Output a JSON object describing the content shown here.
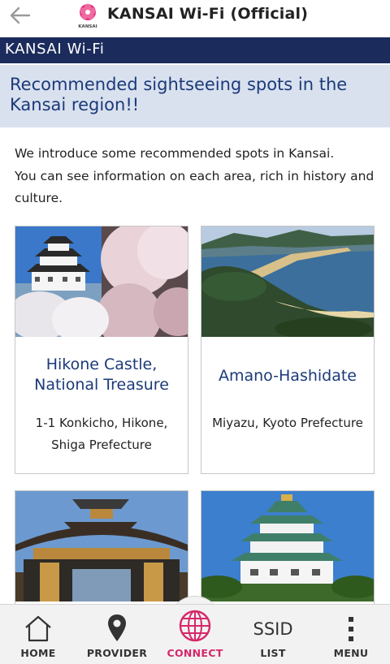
{
  "header": {
    "app_title": "KANSAI Wi-Fi (Official)",
    "logo_caption": "KANSAI"
  },
  "brand_bar": {
    "label": "KANSAI Wi-Fi"
  },
  "section": {
    "title": "Recommended sightseeing spots in the Kansai region!!"
  },
  "intro": {
    "line1": "We introduce some recommended spots in Kansai.",
    "line2": "You can see information on each area, rich in history and culture."
  },
  "spots": [
    {
      "name": "Hikone Castle, National Treasure",
      "address": "1-1 Konkicho, Hikone, Shiga Prefecture"
    },
    {
      "name": "Amano-Hashidate",
      "address": "Miyazu, Kyoto Prefecture"
    },
    {
      "name": "",
      "address": ""
    },
    {
      "name": "",
      "address": ""
    }
  ],
  "bottom_nav": [
    {
      "label": "HOME",
      "icon": "home-icon"
    },
    {
      "label": "PROVIDER",
      "icon": "location-pin-icon"
    },
    {
      "label": "CONNECT",
      "icon": "globe-icon"
    },
    {
      "label": "LIST",
      "icon_text": "SSID"
    },
    {
      "label": "MENU",
      "icon": "menu-dots-icon"
    }
  ],
  "colors": {
    "brand_navy": "#1b2b5c",
    "section_bg": "#d9e1ee",
    "title_blue": "#1b3a7a",
    "connect_accent": "#d6286a",
    "nav_bg": "#f2f2f2"
  }
}
